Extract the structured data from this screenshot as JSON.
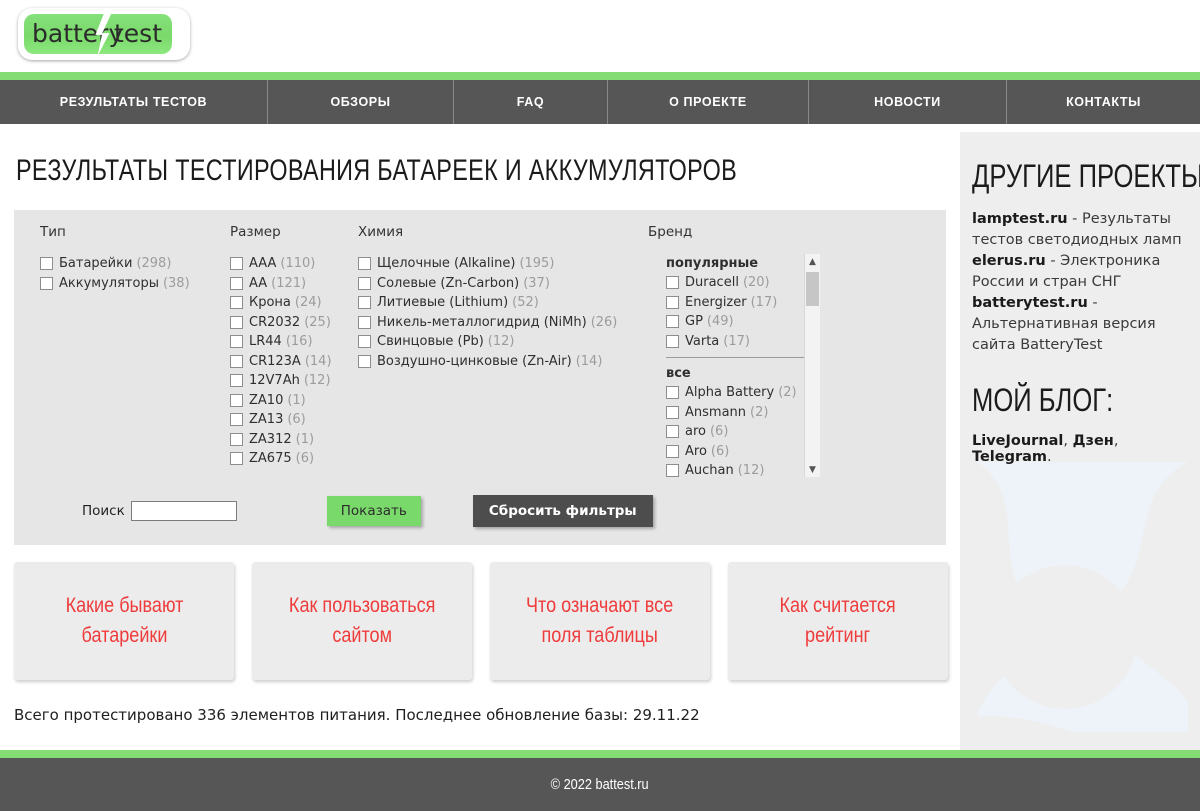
{
  "header": {
    "logo_word_1": "battery",
    "logo_word_2": "test",
    "logo_icon": "battery-bolt-logo"
  },
  "nav": {
    "items": [
      {
        "label": "РЕЗУЛЬТАТЫ ТЕСТОВ"
      },
      {
        "label": "ОБЗОРЫ"
      },
      {
        "label": "FAQ"
      },
      {
        "label": "О ПРОЕКТЕ"
      },
      {
        "label": "НОВОСТИ"
      },
      {
        "label": "КОНТАКТЫ"
      }
    ]
  },
  "main": {
    "page_title": "РЕЗУЛЬТАТЫ ТЕСТИРОВАНИЯ БАТАРЕЕК И АККУМУЛЯТОРОВ",
    "summary": "Всего протестировано 336 элементов питания. Последнее обновление базы: 29.11.22"
  },
  "filters": {
    "type": {
      "heading": "Тип",
      "options": [
        {
          "label": "Батарейки",
          "count": "(298)"
        },
        {
          "label": "Аккумуляторы",
          "count": "(38)"
        }
      ]
    },
    "size": {
      "heading": "Размер",
      "options": [
        {
          "label": "AAA",
          "count": "(110)"
        },
        {
          "label": "AA",
          "count": "(121)"
        },
        {
          "label": "Крона",
          "count": "(24)"
        },
        {
          "label": "CR2032",
          "count": "(25)"
        },
        {
          "label": "LR44",
          "count": "(16)"
        },
        {
          "label": "CR123A",
          "count": "(14)"
        },
        {
          "label": "12V7Ah",
          "count": "(12)"
        },
        {
          "label": "ZA10",
          "count": "(1)"
        },
        {
          "label": "ZA13",
          "count": "(6)"
        },
        {
          "label": "ZA312",
          "count": "(1)"
        },
        {
          "label": "ZA675",
          "count": "(6)"
        }
      ]
    },
    "chemistry": {
      "heading": "Химия",
      "options": [
        {
          "label": "Щелочные (Alkaline)",
          "count": "(195)"
        },
        {
          "label": "Солевые (Zn-Carbon)",
          "count": "(37)"
        },
        {
          "label": "Литиевые (Lithium)",
          "count": "(52)"
        },
        {
          "label": "Никель-металлогидрид (NiMh)",
          "count": "(26)"
        },
        {
          "label": "Свинцовые (Pb)",
          "count": "(12)"
        },
        {
          "label": "Воздушно-цинковые (Zn-Air)",
          "count": "(14)"
        }
      ]
    },
    "brand": {
      "heading": "Бренд",
      "popular_label": "популярные",
      "all_label": "все",
      "popular": [
        {
          "label": "Duracell",
          "count": "(20)"
        },
        {
          "label": "Energizer",
          "count": "(17)"
        },
        {
          "label": "GP",
          "count": "(49)"
        },
        {
          "label": "Varta",
          "count": "(17)"
        }
      ],
      "all": [
        {
          "label": "Alpha Battery",
          "count": "(2)"
        },
        {
          "label": "Ansmann",
          "count": "(2)"
        },
        {
          "label": "aro",
          "count": "(6)"
        },
        {
          "label": "Aro",
          "count": "(6)"
        },
        {
          "label": "Auchan",
          "count": "(12)"
        }
      ]
    },
    "search_label": "Поиск",
    "search_value": "",
    "search_placeholder": "",
    "show_button": "Показать",
    "reset_button": "Сбросить фильтры"
  },
  "cards": [
    {
      "line1": "Какие бывают",
      "line2": "батарейки"
    },
    {
      "line1": "Как пользоваться",
      "line2": "сайтом"
    },
    {
      "line1": "Что означают все",
      "line2": "поля таблицы"
    },
    {
      "line1": "Как считается",
      "line2": "рейтинг"
    }
  ],
  "sidebar": {
    "projects_heading": "ДРУГИЕ ПРОЕКТЫ:",
    "projects": [
      {
        "name": "lamptest.ru",
        "desc": " - Результаты тестов светодиодных ламп"
      },
      {
        "name": "elerus.ru",
        "desc": " - Электроника России и стран СНГ"
      },
      {
        "name": "batterytest.ru",
        "desc": " - Альтернативная версия сайта BatteryTest"
      }
    ],
    "blog_heading": "МОЙ БЛОГ:",
    "blog_links": [
      {
        "label": "LiveJournal"
      },
      {
        "label": "Дзен"
      },
      {
        "label": "Telegram"
      }
    ],
    "blog_sep": ", ",
    "blog_end": "."
  },
  "footer": {
    "copyright": "© 2022 battest.ru"
  },
  "colors": {
    "green": "#7ad96b",
    "dark_gray": "#565656",
    "panel_gray": "#e6e6e6",
    "card_gray": "#ececec",
    "red": "#ef3b3b"
  }
}
